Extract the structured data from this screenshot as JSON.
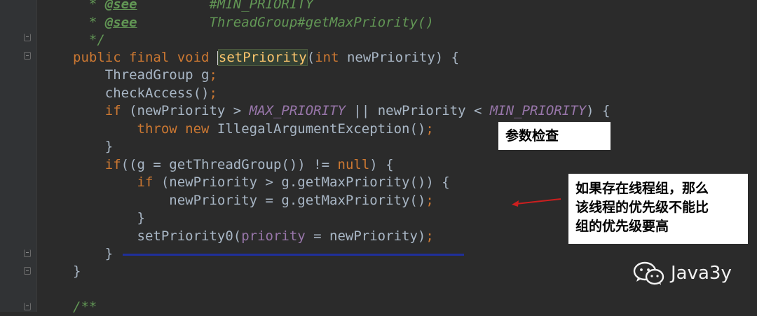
{
  "editor": {
    "lines": [
      {
        "id": "l1",
        "tokens": [
          {
            "t": "  * ",
            "c": "cmt"
          },
          {
            "t": "@see",
            "c": "doctag"
          },
          {
            "t": "         #MIN_PRIORITY",
            "c": "cmt"
          }
        ]
      },
      {
        "id": "l2",
        "tokens": [
          {
            "t": "  * ",
            "c": "cmt"
          },
          {
            "t": "@see",
            "c": "doctag"
          },
          {
            "t": "         ThreadGroup#getMaxPriority()",
            "c": "cmt"
          }
        ]
      },
      {
        "id": "l3",
        "tokens": [
          {
            "t": "  */",
            "c": "cmt"
          }
        ]
      },
      {
        "id": "l4",
        "tokens": [
          {
            "t": "public final void ",
            "c": "kw"
          },
          {
            "t": "|",
            "c": "caret"
          },
          {
            "t": "setPriority",
            "c": "hl-name"
          },
          {
            "t": "(",
            "c": "plain"
          },
          {
            "t": "int ",
            "c": "kw"
          },
          {
            "t": "newPriority) {",
            "c": "plain"
          }
        ]
      },
      {
        "id": "l5",
        "tokens": [
          {
            "t": "    ThreadGroup g",
            "c": "plain"
          },
          {
            "t": ";",
            "c": "punct"
          }
        ]
      },
      {
        "id": "l6",
        "tokens": [
          {
            "t": "    checkAccess()",
            "c": "plain"
          },
          {
            "t": ";",
            "c": "punct"
          }
        ]
      },
      {
        "id": "l7",
        "tokens": [
          {
            "t": "    if ",
            "c": "kw"
          },
          {
            "t": "(newPriority > ",
            "c": "plain"
          },
          {
            "t": "MAX_PRIORITY",
            "c": "const"
          },
          {
            "t": " || newPriority < ",
            "c": "plain"
          },
          {
            "t": "MIN_PRIORITY",
            "c": "const"
          },
          {
            "t": ") {",
            "c": "plain"
          }
        ]
      },
      {
        "id": "l8",
        "tokens": [
          {
            "t": "        throw new ",
            "c": "kw"
          },
          {
            "t": "IllegalArgumentException()",
            "c": "plain"
          },
          {
            "t": ";",
            "c": "punct"
          }
        ]
      },
      {
        "id": "l9",
        "tokens": [
          {
            "t": "    }",
            "c": "plain"
          }
        ]
      },
      {
        "id": "l10",
        "tokens": [
          {
            "t": "    if",
            "c": "kw"
          },
          {
            "t": "((g = getThreadGroup()) != ",
            "c": "plain"
          },
          {
            "t": "null",
            "c": "kw"
          },
          {
            "t": ") {",
            "c": "plain"
          }
        ]
      },
      {
        "id": "l11",
        "tokens": [
          {
            "t": "        if ",
            "c": "kw"
          },
          {
            "t": "(newPriority > g.getMaxPriority()) {",
            "c": "plain"
          }
        ]
      },
      {
        "id": "l12",
        "tokens": [
          {
            "t": "            newPriority = g.getMaxPriority()",
            "c": "plain"
          },
          {
            "t": ";",
            "c": "punct"
          }
        ]
      },
      {
        "id": "l13",
        "tokens": [
          {
            "t": "        }",
            "c": "plain"
          }
        ]
      },
      {
        "id": "l14",
        "tokens": [
          {
            "t": "        setPriority0(",
            "c": "plain"
          },
          {
            "t": "priority",
            "c": "field"
          },
          {
            "t": " = newPriority)",
            "c": "plain"
          },
          {
            "t": ";",
            "c": "punct"
          }
        ]
      },
      {
        "id": "l15",
        "tokens": [
          {
            "t": "    }",
            "c": "plain"
          }
        ]
      },
      {
        "id": "l16",
        "tokens": [
          {
            "t": "}",
            "c": "plain"
          }
        ]
      },
      {
        "id": "l17",
        "tokens": []
      },
      {
        "id": "l18",
        "tokens": [
          {
            "t": "/**",
            "c": "cmt"
          }
        ]
      }
    ]
  },
  "annotations": {
    "param_check": "参数检查",
    "group_limit_lines": [
      "如果存在线程组，那么",
      "该线程的优先级不能比",
      "组的优先级要高"
    ]
  },
  "watermark": {
    "icon": "wechat-icon",
    "label": "Java3y"
  },
  "colors": {
    "background": "#2b2b2b",
    "keyword": "#cc7832",
    "comment": "#629755",
    "constant": "#9876aa",
    "text": "#a9b7c6",
    "method": "#ffc66d",
    "arrow": "#cc1f1f",
    "underline": "#1f2f9a"
  }
}
